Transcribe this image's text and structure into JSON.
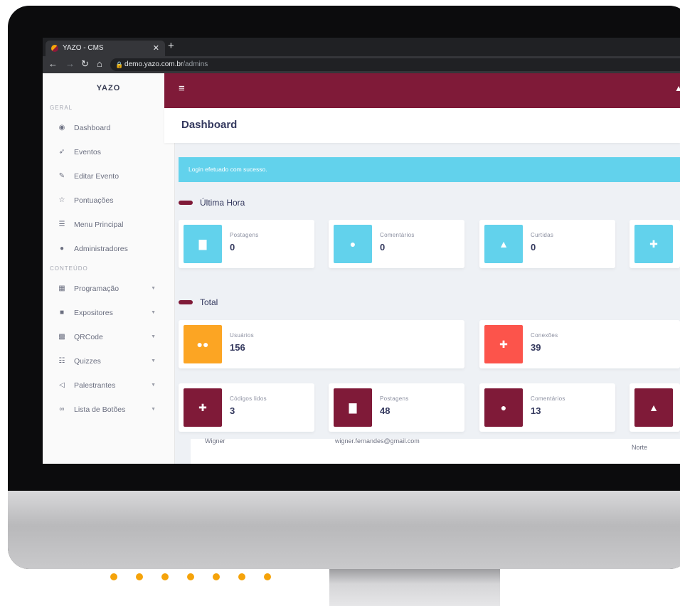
{
  "browser": {
    "tab_title": "YAZO - CMS",
    "url_host": "demo.yazo.com.br",
    "url_path": "/admins"
  },
  "sidebar": {
    "brand": "YAZO",
    "sections": [
      {
        "title": "GERAL",
        "items": [
          {
            "label": "Dashboard",
            "icon": "dashboard-icon"
          },
          {
            "label": "Eventos",
            "icon": "rocket-icon"
          },
          {
            "label": "Editar Evento",
            "icon": "edit-icon"
          },
          {
            "label": "Pontuações",
            "icon": "star-icon"
          },
          {
            "label": "Menu Principal",
            "icon": "list-icon"
          },
          {
            "label": "Administradores",
            "icon": "user-icon"
          }
        ]
      },
      {
        "title": "CONTEÚDO",
        "items": [
          {
            "label": "Programação",
            "icon": "calendar-icon"
          },
          {
            "label": "Expositores",
            "icon": "briefcase-icon"
          },
          {
            "label": "QRCode",
            "icon": "qrcode-icon"
          },
          {
            "label": "Quizzes",
            "icon": "list-ol-icon"
          },
          {
            "label": "Palestrantes",
            "icon": "megaphone-icon"
          },
          {
            "label": "Lista de Botões",
            "icon": "link-icon"
          }
        ]
      }
    ]
  },
  "header": {
    "page_title": "Dashboard"
  },
  "alert": {
    "text": "Login efetuado com sucesso."
  },
  "ultima_hora": {
    "title": "Última Hora",
    "cards": [
      {
        "label": "Postagens",
        "value": "0",
        "icon": "file-icon",
        "color": "#62d2ec"
      },
      {
        "label": "Comentários",
        "value": "0",
        "icon": "comment-icon",
        "color": "#62d2ec"
      },
      {
        "label": "Curtidas",
        "value": "0",
        "icon": "thumbs-up-icon",
        "color": "#62d2ec"
      },
      {
        "label": "",
        "value": "",
        "icon": "user-plus-icon",
        "color": "#62d2ec"
      }
    ]
  },
  "total": {
    "title": "Total",
    "cards": [
      {
        "label": "Usuários",
        "value": "156",
        "icon": "users-icon",
        "color": "#fca523"
      },
      {
        "label": "Conexões",
        "value": "39",
        "icon": "user-plus-icon",
        "color": "#fc544b"
      },
      {
        "label": "Códigos lidos",
        "value": "3",
        "icon": "user-plus-icon",
        "color": "#7f1a38"
      },
      {
        "label": "Postagens",
        "value": "48",
        "icon": "file-icon",
        "color": "#7f1a38"
      },
      {
        "label": "Comentários",
        "value": "13",
        "icon": "comment-icon",
        "color": "#7f1a38"
      },
      {
        "label": "",
        "value": "",
        "icon": "thumbs-up-icon",
        "color": "#7f1a38"
      }
    ]
  },
  "background_table": {
    "name": "Wigner",
    "email": "wigner.fernandes@gmail.com",
    "region": "Norte"
  },
  "colors": {
    "brand": "#7f1a38",
    "info": "#62d2ec",
    "warning": "#fca523",
    "danger": "#fc544b"
  }
}
